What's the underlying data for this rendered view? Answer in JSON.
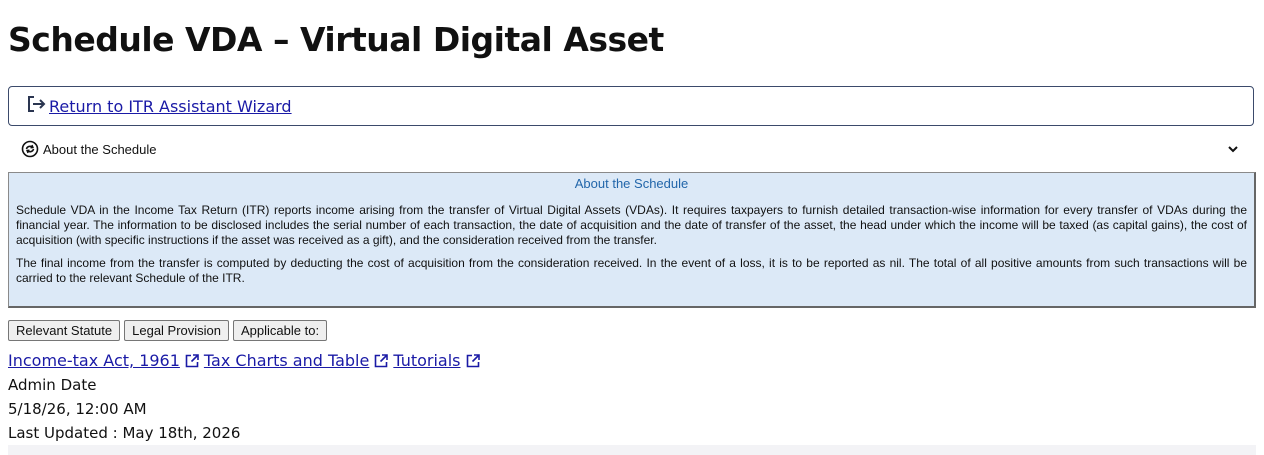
{
  "page": {
    "title": "Schedule VDA – Virtual Digital Asset"
  },
  "return_link": {
    "label": "Return to ITR Assistant Wizard",
    "icon": "sign-out-icon"
  },
  "about": {
    "toggle_label": "About the Schedule",
    "toggle_icon": "info-circle-icon",
    "chevron_icon": "chevron-down-icon",
    "panel_title": "About the Schedule",
    "paragraphs": [
      "Schedule VDA in the Income Tax Return (ITR) reports income arising from the transfer of Virtual Digital Assets (VDAs). It requires taxpayers to furnish detailed transaction-wise information for every transfer of VDAs during the financial year. The information to be disclosed includes the serial number of each transaction, the date of acquisition and the date of transfer of the asset, the head under which the income will be taxed (as capital gains), the cost of acquisition (with specific instructions if the asset was received as a gift), and the consideration received from the transfer.",
      "The final income from the transfer is computed by deducting the cost of acquisition from the consideration received. In the event of a loss, it is to be reported as nil. The total of all positive amounts from such transactions will be carried to the relevant Schedule of the ITR."
    ],
    "panel_bg": "#dce9f7",
    "panel_title_color": "#2266aa"
  },
  "buttons": {
    "relevant_statute": "Relevant Statute",
    "legal_provision": "Legal Provision",
    "applicable_to": "Applicable to:"
  },
  "links": [
    {
      "label": "Income-tax Act, 1961",
      "icon": "external-link-icon"
    },
    {
      "label": "Tax Charts and Table",
      "icon": "external-link-icon"
    },
    {
      "label": "Tutorials",
      "icon": "external-link-icon"
    }
  ],
  "meta": {
    "admin_date_label": "Admin Date",
    "admin_date_value": "5/18/26, 12:00 AM",
    "last_updated": "Last Updated : May 18th, 2026"
  },
  "colors": {
    "link": "#1a1aa6",
    "border": "#3b4a6b"
  }
}
